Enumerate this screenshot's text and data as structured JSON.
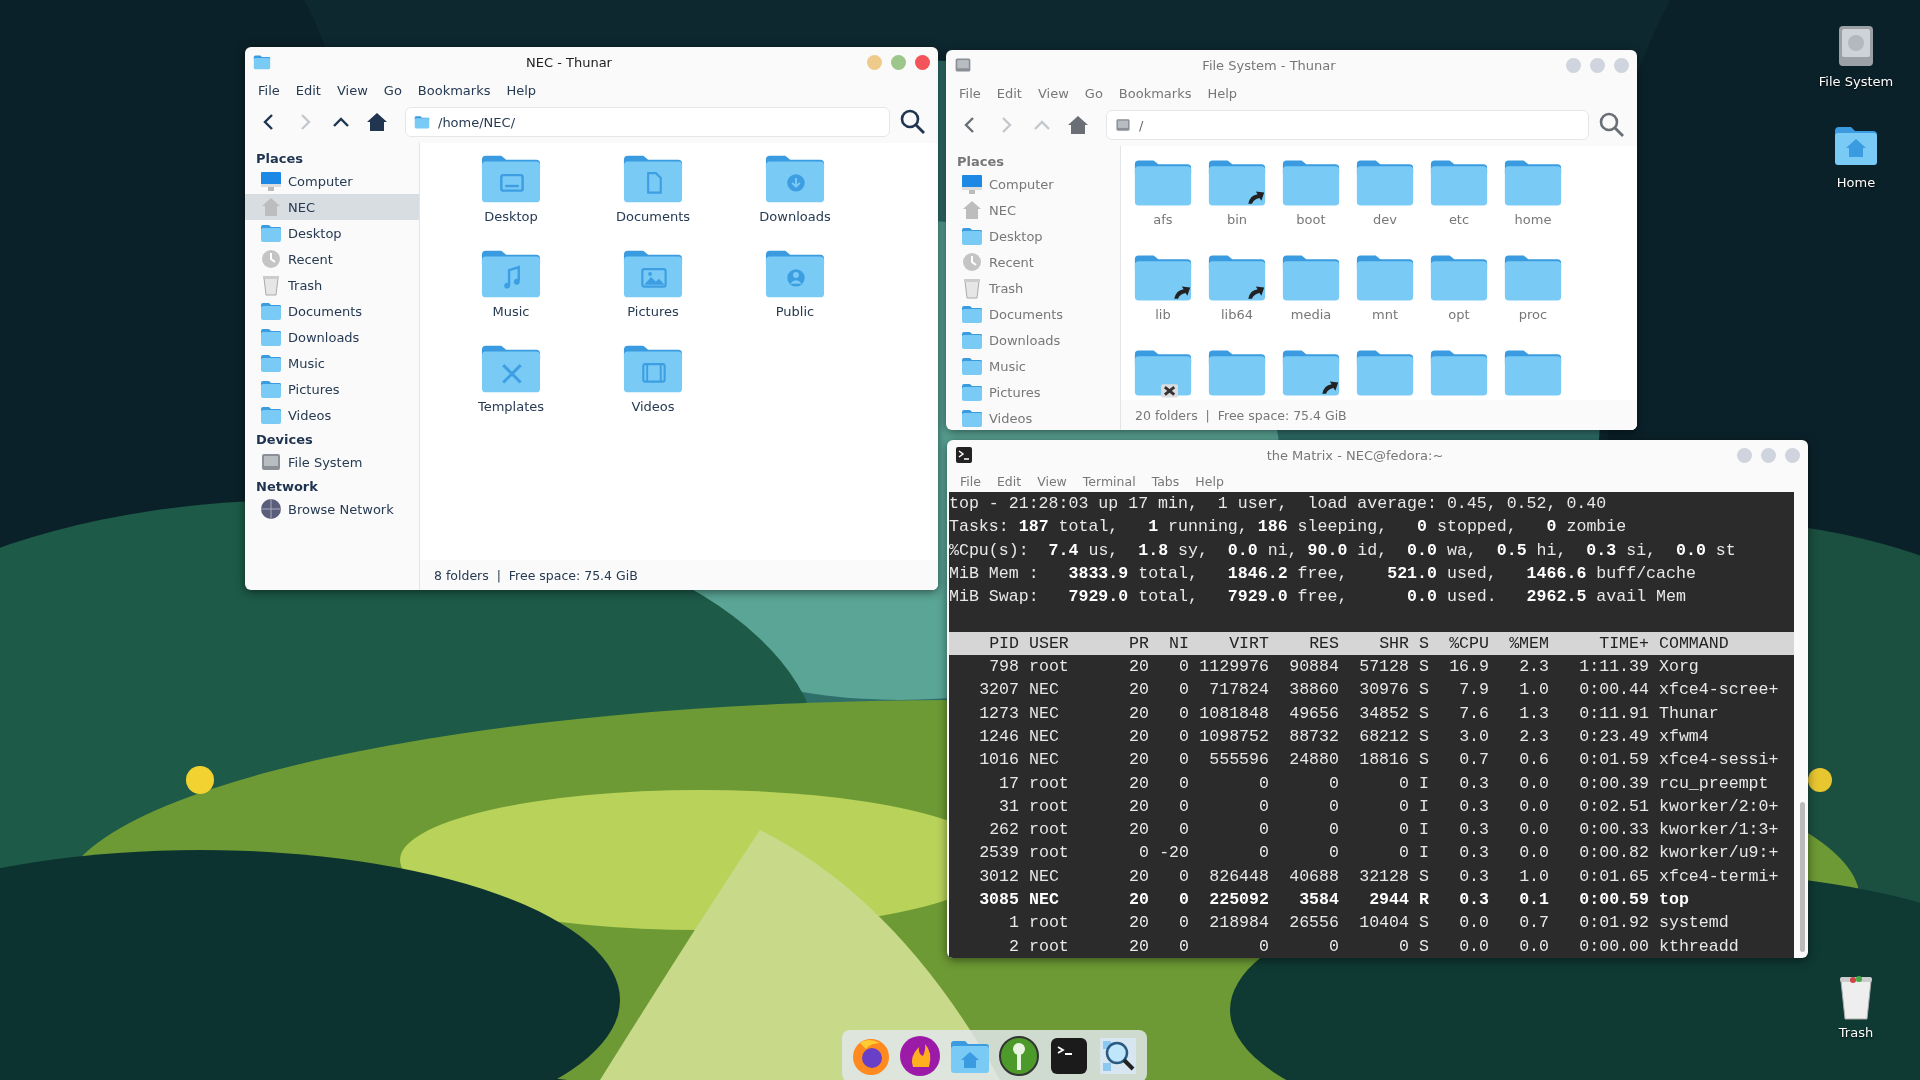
{
  "desktop": {
    "icons": [
      {
        "label": "File System",
        "kind": "drive"
      },
      {
        "label": "Home",
        "kind": "home"
      },
      {
        "label": "Trash",
        "kind": "trash"
      }
    ]
  },
  "windows": [
    {
      "kind": "file_manager",
      "title": "NEC - Thunar",
      "active": true,
      "menu": [
        "File",
        "Edit",
        "View",
        "Go",
        "Bookmarks",
        "Help"
      ],
      "nav": [
        {
          "kind": "back",
          "disabled": false
        },
        {
          "kind": "forward",
          "disabled": true
        },
        {
          "kind": "up",
          "disabled": false
        },
        {
          "kind": "home",
          "disabled": false
        }
      ],
      "path": "/home/NEC/",
      "sidebar": [
        {
          "heading": "Places",
          "items": [
            {
              "label": "Computer",
              "kind": "computer",
              "selected": false
            },
            {
              "label": "NEC",
              "kind": "home",
              "selected": true
            },
            {
              "label": "Desktop",
              "kind": "folder",
              "selected": false
            },
            {
              "label": "Recent",
              "kind": "recent",
              "selected": false
            },
            {
              "label": "Trash",
              "kind": "trash",
              "selected": false
            },
            {
              "label": "Documents",
              "kind": "folder",
              "selected": false
            },
            {
              "label": "Downloads",
              "kind": "folder",
              "selected": false
            },
            {
              "label": "Music",
              "kind": "folder",
              "selected": false
            },
            {
              "label": "Pictures",
              "kind": "folder",
              "selected": false
            },
            {
              "label": "Videos",
              "kind": "folder",
              "selected": false
            }
          ]
        },
        {
          "heading": "Devices",
          "items": [
            {
              "label": "File System",
              "kind": "drive",
              "selected": false
            }
          ]
        },
        {
          "heading": "Network",
          "items": [
            {
              "label": "Browse Network",
              "kind": "network",
              "selected": false
            }
          ]
        }
      ],
      "items": [
        {
          "name": "Desktop",
          "kind": "desktop"
        },
        {
          "name": "Documents",
          "kind": "document"
        },
        {
          "name": "Downloads",
          "kind": "download"
        },
        {
          "name": "Music",
          "kind": "music"
        },
        {
          "name": "Pictures",
          "kind": "picture"
        },
        {
          "name": "Public",
          "kind": "person"
        },
        {
          "name": "Templates",
          "kind": "tools"
        },
        {
          "name": "Videos",
          "kind": "film"
        }
      ],
      "status": "8 folders  |  Free space: 75.4 GiB"
    },
    {
      "kind": "file_manager",
      "title": "File System - Thunar",
      "active": false,
      "menu": [
        "File",
        "Edit",
        "View",
        "Go",
        "Bookmarks",
        "Help"
      ],
      "nav": [
        {
          "kind": "back",
          "disabled": false
        },
        {
          "kind": "forward",
          "disabled": true
        },
        {
          "kind": "up",
          "disabled": true
        },
        {
          "kind": "home",
          "disabled": false
        }
      ],
      "path": "/",
      "sidebar": [
        {
          "heading": "Places",
          "items": [
            {
              "label": "Computer",
              "kind": "computer",
              "selected": false
            },
            {
              "label": "NEC",
              "kind": "home",
              "selected": false
            },
            {
              "label": "Desktop",
              "kind": "folder",
              "selected": false
            },
            {
              "label": "Recent",
              "kind": "recent",
              "selected": false
            },
            {
              "label": "Trash",
              "kind": "trash",
              "selected": false
            },
            {
              "label": "Documents",
              "kind": "folder",
              "selected": false
            },
            {
              "label": "Downloads",
              "kind": "folder",
              "selected": false
            },
            {
              "label": "Music",
              "kind": "folder",
              "selected": false
            },
            {
              "label": "Pictures",
              "kind": "folder",
              "selected": false
            },
            {
              "label": "Videos",
              "kind": "folder",
              "selected": false
            }
          ]
        }
      ],
      "items": [
        {
          "name": "afs",
          "kind": "folder"
        },
        {
          "name": "bin",
          "kind": "link"
        },
        {
          "name": "boot",
          "kind": "folder"
        },
        {
          "name": "dev",
          "kind": "folder"
        },
        {
          "name": "etc",
          "kind": "folder"
        },
        {
          "name": "home",
          "kind": "folder"
        },
        {
          "name": "lib",
          "kind": "link"
        },
        {
          "name": "lib64",
          "kind": "link"
        },
        {
          "name": "media",
          "kind": "folder"
        },
        {
          "name": "mnt",
          "kind": "folder"
        },
        {
          "name": "opt",
          "kind": "folder"
        },
        {
          "name": "proc",
          "kind": "folder"
        },
        {
          "kind": "unreadable"
        },
        {
          "kind": "folder"
        },
        {
          "kind": "link"
        },
        {
          "kind": "folder"
        },
        {
          "kind": "folder"
        },
        {
          "kind": "folder"
        }
      ],
      "status": "20 folders  |  Free space: 75.4 GiB"
    },
    {
      "kind": "terminal",
      "title": "the Matrix - NEC@fedora:~",
      "active": false,
      "menu": [
        "File",
        "Edit",
        "View",
        "Terminal",
        "Tabs",
        "Help"
      ],
      "summary": [
        "top - 21:28:03 up 17 min,  1 user,  load average: 0.45, 0.52, 0.40",
        "Tasks: **187** total,   **1** running, **186** sleeping,   **0** stopped,   **0** zombie",
        "%Cpu(s):  **7.4** us,  **1.8** sy,  **0.0** ni, **90.0** id,  **0.0** wa,  **0.5** hi,  **0.3** si,  **0.0** st",
        "MiB Mem :   **3833.9** total,   **1846.2** free,    **521.0** used,   **1466.6** buff/cache",
        "MiB Swap:   **7929.0** total,   **7929.0** free,      **0.0** used.   **2962.5** avail Mem"
      ],
      "columns": [
        "PID",
        "USER",
        "PR",
        "NI",
        "VIRT",
        "RES",
        "SHR",
        "S",
        "%CPU",
        "%MEM",
        "TIME+",
        "COMMAND"
      ],
      "rows": [
        {
          "bold": false,
          "cells": [
            "798",
            "root",
            "20",
            "0",
            "1129976",
            "90884",
            "57128",
            "S",
            "16.9",
            "2.3",
            "1:11.39",
            "Xorg"
          ]
        },
        {
          "bold": false,
          "cells": [
            "3207",
            "NEC",
            "20",
            "0",
            "717824",
            "38860",
            "30976",
            "S",
            "7.9",
            "1.0",
            "0:00.44",
            "xfce4-scree+"
          ]
        },
        {
          "bold": false,
          "cells": [
            "1273",
            "NEC",
            "20",
            "0",
            "1081848",
            "49656",
            "34852",
            "S",
            "7.6",
            "1.3",
            "0:11.91",
            "Thunar"
          ]
        },
        {
          "bold": false,
          "cells": [
            "1246",
            "NEC",
            "20",
            "0",
            "1098752",
            "88732",
            "68212",
            "S",
            "3.0",
            "2.3",
            "0:23.49",
            "xfwm4"
          ]
        },
        {
          "bold": false,
          "cells": [
            "1016",
            "NEC",
            "20",
            "0",
            "555596",
            "24880",
            "18816",
            "S",
            "0.7",
            "0.6",
            "0:01.59",
            "xfce4-sessi+"
          ]
        },
        {
          "bold": false,
          "cells": [
            "17",
            "root",
            "20",
            "0",
            "0",
            "0",
            "0",
            "I",
            "0.3",
            "0.0",
            "0:00.39",
            "rcu_preempt"
          ]
        },
        {
          "bold": false,
          "cells": [
            "31",
            "root",
            "20",
            "0",
            "0",
            "0",
            "0",
            "I",
            "0.3",
            "0.0",
            "0:02.51",
            "kworker/2:0+"
          ]
        },
        {
          "bold": false,
          "cells": [
            "262",
            "root",
            "20",
            "0",
            "0",
            "0",
            "0",
            "I",
            "0.3",
            "0.0",
            "0:00.33",
            "kworker/1:3+"
          ]
        },
        {
          "bold": false,
          "cells": [
            "2539",
            "root",
            "0",
            "-20",
            "0",
            "0",
            "0",
            "I",
            "0.3",
            "0.0",
            "0:00.82",
            "kworker/u9:+"
          ]
        },
        {
          "bold": false,
          "cells": [
            "3012",
            "NEC",
            "20",
            "0",
            "826448",
            "40688",
            "32128",
            "S",
            "0.3",
            "1.0",
            "0:01.65",
            "xfce4-termi+"
          ]
        },
        {
          "bold": true,
          "cells": [
            "3085",
            "NEC",
            "20",
            "0",
            "225092",
            "3584",
            "2944",
            "R",
            "0.3",
            "0.1",
            "0:00.59",
            "top"
          ]
        },
        {
          "bold": false,
          "cells": [
            "1",
            "root",
            "20",
            "0",
            "218984",
            "26556",
            "10404",
            "S",
            "0.0",
            "0.7",
            "0:01.92",
            "systemd"
          ]
        },
        {
          "bold": false,
          "cells": [
            "2",
            "root",
            "20",
            "0",
            "0",
            "0",
            "0",
            "S",
            "0.0",
            "0.0",
            "0:00.00",
            "kthreadd"
          ]
        }
      ]
    }
  ],
  "dock": [
    {
      "kind": "firefox"
    },
    {
      "kind": "flame"
    },
    {
      "kind": "home_folder"
    },
    {
      "kind": "key"
    },
    {
      "kind": "terminal"
    },
    {
      "kind": "search"
    }
  ]
}
